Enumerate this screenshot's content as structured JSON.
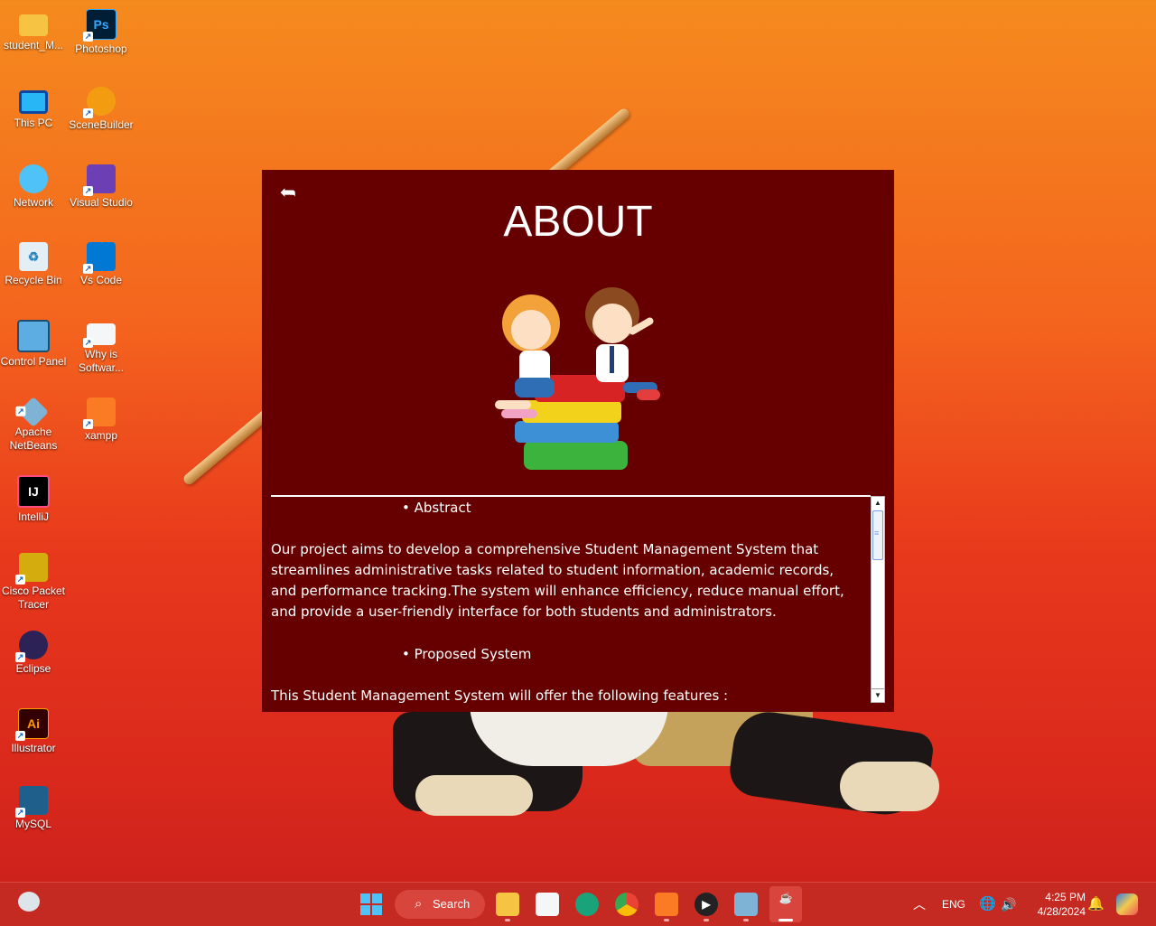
{
  "desktop": {
    "icons": [
      {
        "label": "student_M...",
        "glyph": "folder-icon"
      },
      {
        "label": "Photoshop",
        "glyph": "photoshop-icon",
        "text": "Ps"
      },
      {
        "label": "This PC",
        "glyph": "monitor-icon"
      },
      {
        "label": "SceneBuilder",
        "glyph": "scenebuilder-icon"
      },
      {
        "label": "Network",
        "glyph": "network-icon"
      },
      {
        "label": "Visual Studio",
        "glyph": "visual-studio-icon"
      },
      {
        "label": "Recycle Bin",
        "glyph": "recycle-bin-icon"
      },
      {
        "label": "Vs Code",
        "glyph": "vscode-icon"
      },
      {
        "label": "Control Panel",
        "glyph": "control-panel-icon"
      },
      {
        "label": "Why is Softwar...",
        "glyph": "document-icon"
      },
      {
        "label": "Apache NetBeans",
        "glyph": "netbeans-icon"
      },
      {
        "label": "xampp",
        "glyph": "xampp-icon"
      },
      {
        "label": "IntelliJ",
        "glyph": "intellij-icon",
        "text": "IJ"
      },
      {
        "label": "Cisco Packet Tracer",
        "glyph": "cisco-icon"
      },
      {
        "label": "Eclipse",
        "glyph": "eclipse-icon"
      },
      {
        "label": "Illustrator",
        "glyph": "illustrator-icon",
        "text": "Ai"
      },
      {
        "label": "MySQL",
        "glyph": "mysql-icon"
      }
    ]
  },
  "about": {
    "back_symbol": "➦",
    "title": "ABOUT",
    "content": {
      "bullet1": "• Abstract",
      "para1_lines": [
        "Our project aims to develop a comprehensive Student Management System that",
        "streamlines administrative tasks related to student information, academic records,",
        "and performance tracking.The system will enhance efficiency, reduce manual effort,",
        "and provide a user-friendly interface for both students and administrators."
      ],
      "bullet2": "• Proposed System",
      "para2": "This Student Management System will offer the following features :"
    }
  },
  "taskbar": {
    "search_label": "Search",
    "language": "ENG",
    "time": "4:25 PM",
    "date": "4/28/2024",
    "apps": [
      "file-explorer-icon",
      "store-icon",
      "edge-icon",
      "chrome-icon",
      "xampp-icon",
      "media-player-icon",
      "netbeans-icon",
      "java-icon"
    ]
  },
  "colors": {
    "window_bg": "#660000",
    "taskbar_bg": "#c42a22"
  }
}
